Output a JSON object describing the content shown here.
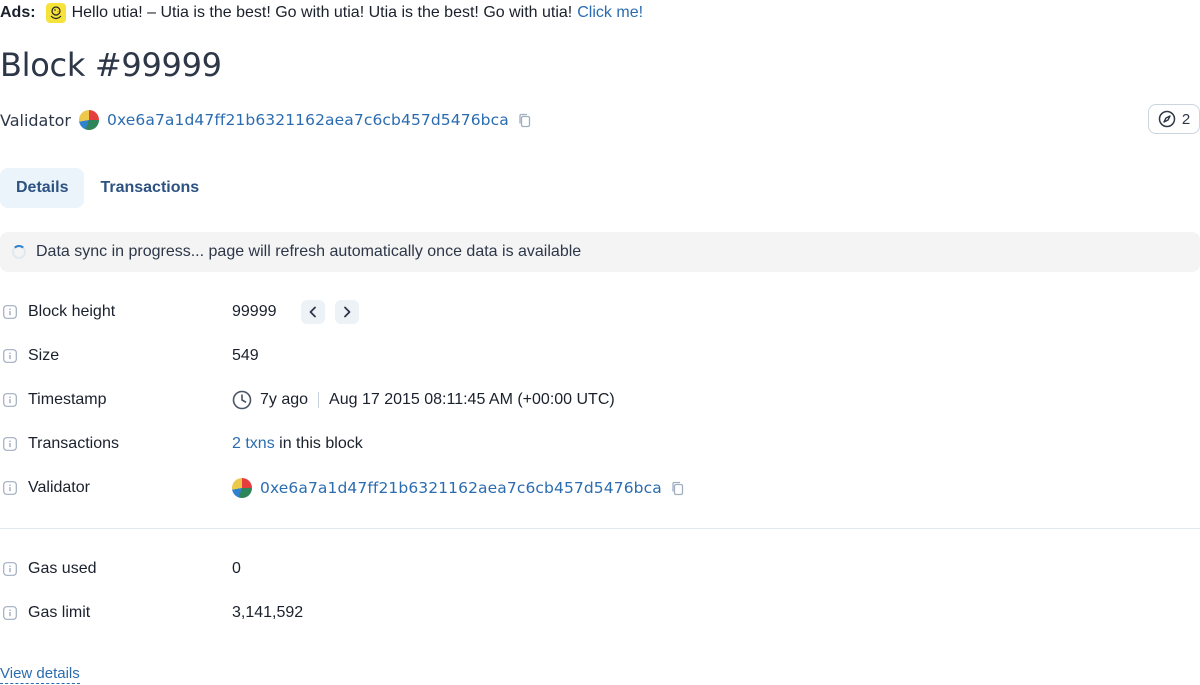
{
  "ads": {
    "label": "Ads:",
    "text": "Hello utia! – Utia is the best! Go with utia! Utia is the best! Go with utia!",
    "link": "Click me!"
  },
  "header": {
    "title": "Block #99999",
    "validator_label": "Validator",
    "validator_address": "0xe6a7a1d47ff21b6321162aea7c6cb457d5476bca",
    "badge_count": "2"
  },
  "tabs": [
    {
      "label": "Details",
      "active": true
    },
    {
      "label": "Transactions",
      "active": false
    }
  ],
  "sync_notice": "Data sync in progress... page will refresh automatically once data is available",
  "details": {
    "block_height": {
      "label": "Block height",
      "value": "99999"
    },
    "size": {
      "label": "Size",
      "value": "549"
    },
    "timestamp": {
      "label": "Timestamp",
      "relative": "7y ago",
      "absolute": "Aug 17 2015 08:11:45 AM (+00:00 UTC)"
    },
    "transactions": {
      "label": "Transactions",
      "link": "2 txns",
      "suffix": " in this block"
    },
    "validator": {
      "label": "Validator",
      "address": "0xe6a7a1d47ff21b6321162aea7c6cb457d5476bca"
    },
    "gas_used": {
      "label": "Gas used",
      "value": "0"
    },
    "gas_limit": {
      "label": "Gas limit",
      "value": "3,141,592"
    }
  },
  "footer": {
    "view_details": "View details"
  },
  "colors": {
    "link": "#2b6cb0",
    "tab_active_bg": "#ebf4fb",
    "sync_bg": "#f4f4f4"
  }
}
